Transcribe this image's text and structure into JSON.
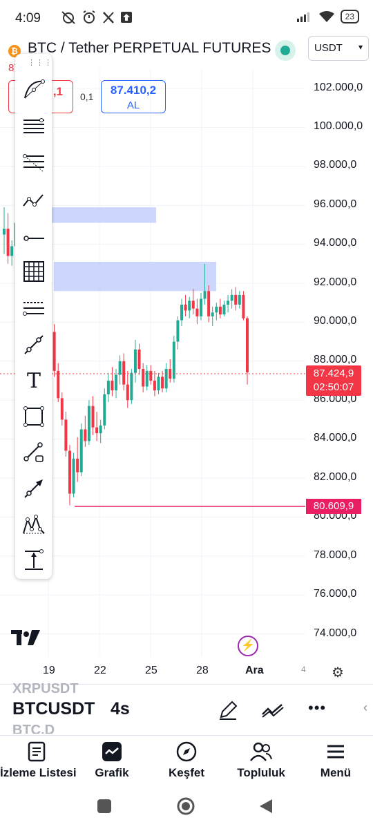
{
  "status": {
    "time": "4:09",
    "battery": "23",
    "left_icons": [
      "muted-alarm-icon",
      "alarm-clock-icon",
      "x-icon",
      "upload-icon"
    ],
    "right_icons": [
      "signal-icon",
      "wifi-icon",
      "battery-icon"
    ]
  },
  "header": {
    "symbol_title": "BTC / Tether PERPETUAL FUTURES",
    "coin_badge": "₿",
    "currency": "USDT",
    "current_price_partial": "87.4​24,9"
  },
  "trade": {
    "sell_price_partial": ",1",
    "spread": "0,1",
    "buy_price": "87.410,2",
    "buy_label": "AL"
  },
  "chart": {
    "price_axis": [
      "102.000,0",
      "100.000,0",
      "98.000,0",
      "96.000,0",
      "94.000,0",
      "92.000,0",
      "90.000,0",
      "88.000,0",
      "86.000,0",
      "84.000,0",
      "82.000,0",
      "80.000,0",
      "78.000,0",
      "76.000,0",
      "74.000,0"
    ],
    "current_price_tag": "87.424,9",
    "countdown_tag": "02:50:07",
    "horizontal_line_tag": "80.609,9",
    "time_axis": [
      "19",
      "22",
      "25",
      "28",
      "Ara",
      "4"
    ],
    "colors": {
      "up": "#22ab94",
      "down": "#f23645",
      "zone": "#c7d3fb",
      "hline": "#e91e63"
    }
  },
  "chart_data": {
    "type": "candlestick",
    "title": "",
    "xlabel": "",
    "ylabel": "",
    "ylim": [
      73000,
      103000
    ],
    "zones": [
      {
        "from_price": 95100,
        "to_price": 95900
      },
      {
        "from_price": 91600,
        "to_price": 93100
      }
    ],
    "horizontal_line": 80609.9,
    "last_price": 87424.9,
    "candles": [
      [
        94500,
        95900,
        93500,
        94800
      ],
      [
        94800,
        95600,
        93000,
        93400
      ],
      [
        93400,
        94200,
        92900,
        93900
      ],
      [
        93900,
        95400,
        93700,
        95100
      ],
      [
        95100,
        95500,
        91000,
        91300
      ],
      [
        91300,
        92000,
        90000,
        90500
      ],
      [
        90500,
        91800,
        88400,
        88700
      ],
      [
        88700,
        90300,
        88500,
        89900
      ],
      [
        89900,
        92300,
        89600,
        92000
      ],
      [
        92000,
        93100,
        91400,
        91800
      ],
      [
        91800,
        92600,
        90700,
        91000
      ],
      [
        91000,
        92400,
        90900,
        92100
      ],
      [
        92100,
        92500,
        89200,
        89500
      ],
      [
        89500,
        89900,
        87200,
        87500
      ],
      [
        87500,
        87900,
        85900,
        86100
      ],
      [
        86100,
        86400,
        84700,
        85000
      ],
      [
        85000,
        85400,
        83100,
        83400
      ],
      [
        83400,
        83700,
        80600,
        81200
      ],
      [
        81200,
        83300,
        81000,
        83000
      ],
      [
        83000,
        84100,
        81800,
        82300
      ],
      [
        82300,
        84800,
        82100,
        84500
      ],
      [
        84500,
        85200,
        83600,
        83900
      ],
      [
        83900,
        86000,
        83700,
        85700
      ],
      [
        85700,
        86200,
        84200,
        84600
      ],
      [
        84600,
        85400,
        83900,
        84300
      ],
      [
        84300,
        85000,
        83800,
        84700
      ],
      [
        84700,
        86600,
        84500,
        86300
      ],
      [
        86300,
        87400,
        85900,
        87000
      ],
      [
        87000,
        87700,
        86200,
        86500
      ],
      [
        86500,
        87600,
        86100,
        87300
      ],
      [
        87300,
        88300,
        86800,
        88000
      ],
      [
        88000,
        88400,
        86500,
        86800
      ],
      [
        86800,
        87500,
        85600,
        86000
      ],
      [
        86000,
        87600,
        85800,
        87400
      ],
      [
        87400,
        89100,
        86900,
        88600
      ],
      [
        88600,
        88900,
        87300,
        87600
      ],
      [
        87600,
        87900,
        86400,
        86700
      ],
      [
        86700,
        87800,
        86500,
        87500
      ],
      [
        87500,
        87800,
        86800,
        87000
      ],
      [
        87000,
        87500,
        86200,
        86500
      ],
      [
        86500,
        87400,
        86300,
        87200
      ],
      [
        87200,
        87500,
        86400,
        86600
      ],
      [
        86600,
        87900,
        86400,
        87600
      ],
      [
        87600,
        88100,
        86900,
        87100
      ],
      [
        87100,
        89300,
        86900,
        89000
      ],
      [
        89000,
        90300,
        88600,
        90100
      ],
      [
        90100,
        91200,
        89800,
        90900
      ],
      [
        90900,
        91400,
        90300,
        90600
      ],
      [
        90600,
        91300,
        90200,
        91100
      ],
      [
        91100,
        91700,
        90400,
        90700
      ],
      [
        90700,
        91200,
        89900,
        90300
      ],
      [
        90300,
        91500,
        90100,
        91200
      ],
      [
        91200,
        93000,
        90900,
        91600
      ],
      [
        91600,
        91900,
        90000,
        90300
      ],
      [
        90300,
        90800,
        89800,
        90500
      ],
      [
        90500,
        91000,
        90100,
        90800
      ],
      [
        90800,
        91200,
        90200,
        90400
      ],
      [
        90400,
        91100,
        90300,
        90900
      ],
      [
        90900,
        91400,
        90500,
        91100
      ],
      [
        91100,
        91700,
        90700,
        91400
      ],
      [
        91400,
        91800,
        90600,
        90900
      ],
      [
        90900,
        91600,
        90700,
        91400
      ],
      [
        91400,
        91600,
        90100,
        90200
      ],
      [
        90200,
        90300,
        86800,
        87425
      ]
    ]
  },
  "toolbox": {
    "grip": "⋮⋮⋮",
    "tools": [
      "curve-tool-icon",
      "horizontal-lines-icon",
      "fib-retracement-icon",
      "polyline-icon",
      "horizontal-ray-icon",
      "grid-icon",
      "pitchfork-icon",
      "trend-line-icon",
      "text-tool-icon",
      "rectangle-tool-icon",
      "path-tool-icon",
      "arrow-tool-icon",
      "pattern-tool-icon",
      "price-range-icon"
    ],
    "text_tool_glyph": "T"
  },
  "symbols": {
    "ghost_above": "XRPUSDT",
    "main": "BTCUSDT",
    "interval": "4s",
    "ghost_below": "BTC.D",
    "more": "•••",
    "collapse": "‹"
  },
  "bottom_nav": {
    "items": [
      {
        "label": "İzleme Listesi",
        "icon": "watchlist-icon"
      },
      {
        "label": "Grafik",
        "icon": "chart-icon"
      },
      {
        "label": "Keşfet",
        "icon": "compass-icon"
      },
      {
        "label": "Topluluk",
        "icon": "community-icon"
      },
      {
        "label": "Menü",
        "icon": "menu-icon"
      }
    ]
  },
  "misc": {
    "bolt": "⚡",
    "settings": "⚙"
  }
}
